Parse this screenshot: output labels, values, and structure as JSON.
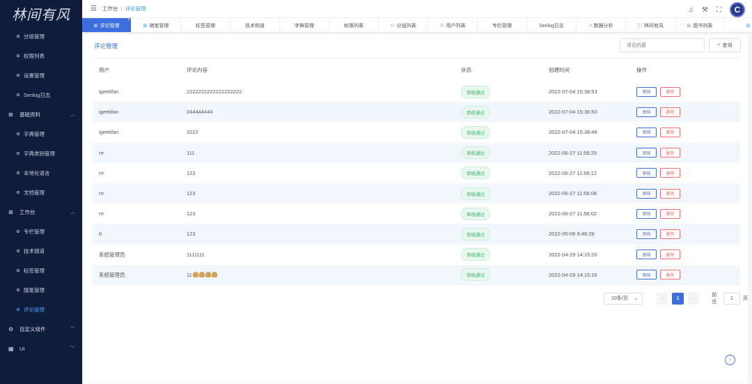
{
  "sidebar": {
    "logo": "林间有风",
    "items": [
      {
        "type": "item",
        "label": "分组管理"
      },
      {
        "type": "item",
        "label": "权限列表"
      },
      {
        "type": "item",
        "label": "设置管理"
      },
      {
        "type": "item",
        "label": "Serilog日志"
      },
      {
        "type": "group",
        "label": "基础资料",
        "icon": "book-icon",
        "chevron": "︿"
      },
      {
        "type": "item",
        "label": "字典管理"
      },
      {
        "type": "item",
        "label": "字典类别管理"
      },
      {
        "type": "item",
        "label": "本地化语言"
      },
      {
        "type": "item",
        "label": "文档管理"
      },
      {
        "type": "group",
        "label": "工作台",
        "icon": "book-icon",
        "chevron": "︿"
      },
      {
        "type": "item",
        "label": "专栏管理"
      },
      {
        "type": "item",
        "label": "技术频道"
      },
      {
        "type": "item",
        "label": "标签管理"
      },
      {
        "type": "item",
        "label": "随笔管理"
      },
      {
        "type": "item",
        "label": "评论管理",
        "active": true
      },
      {
        "type": "group",
        "label": "自定义组件",
        "icon": "gear-icon",
        "chevron": "﹀"
      },
      {
        "type": "group",
        "label": "UI",
        "icon": "grid-icon",
        "chevron": "﹀"
      }
    ]
  },
  "header": {
    "breadcrumb": [
      "工作台",
      "评论管理"
    ]
  },
  "tabs": [
    {
      "label": "评论管理",
      "icon": "book-icon",
      "active": true
    },
    {
      "label": "随笔管理",
      "icon": "book-icon"
    },
    {
      "label": "标签管理"
    },
    {
      "label": "技术频道"
    },
    {
      "label": "字典管理"
    },
    {
      "label": "权限列表"
    },
    {
      "label": "分组列表",
      "icon": "user-icon"
    },
    {
      "label": "用户列表",
      "icon": "user-icon"
    },
    {
      "label": "专栏管理"
    },
    {
      "label": "Serilog日志"
    },
    {
      "label": "数据分析",
      "icon": "chart-icon"
    },
    {
      "label": "林间有风",
      "icon": "info-icon"
    },
    {
      "label": "图书列表",
      "icon": "book-icon"
    },
    {
      "label": "",
      "icon": "book-icon"
    }
  ],
  "main": {
    "title": "评论管理",
    "search_placeholder": "评论内容",
    "search_button": "查询"
  },
  "table": {
    "columns": [
      "用户",
      "评论内容",
      "状态",
      "创建时间",
      "操作"
    ],
    "rows": [
      {
        "user": "igeekfan",
        "content": "2222222222222222222",
        "status": "审核通过",
        "time": "2022-07-04 15:38:53"
      },
      {
        "user": "igeekfan",
        "content": "244444444",
        "status": "审核通过",
        "time": "2022-07-04 15:38:50"
      },
      {
        "user": "igeekfan",
        "content": "3222",
        "status": "审核通过",
        "time": "2022-07-04 15:38:48"
      },
      {
        "user": "rrr",
        "content": "111",
        "status": "审核通过",
        "time": "2022-06-27 11:56:25"
      },
      {
        "user": "rrr",
        "content": "123",
        "status": "审核通过",
        "time": "2022-06-27 11:56:12"
      },
      {
        "user": "rrr",
        "content": "123",
        "status": "审核通过",
        "time": "2022-06-27 11:56:08"
      },
      {
        "user": "rrr",
        "content": "123",
        "status": "审核通过",
        "time": "2022-06-27 11:56:02"
      },
      {
        "user": "tt",
        "content": "123",
        "status": "审核通过",
        "time": "2022-05-06 9:48:29"
      },
      {
        "user": "系统管理员",
        "content": "1111111",
        "status": "审核通过",
        "time": "2022-04-29 14:15:20"
      },
      {
        "user": "系统管理员",
        "content": "11",
        "emoji_count": 4,
        "status": "审核通过",
        "time": "2022-04-29 14:15:16"
      }
    ],
    "action_audit": "审核",
    "action_delete": "删除"
  },
  "pagination": {
    "page_size": "10条/页",
    "current_page": "1",
    "goto_prefix": "前往",
    "goto_value": "1",
    "goto_suffix": "页"
  }
}
